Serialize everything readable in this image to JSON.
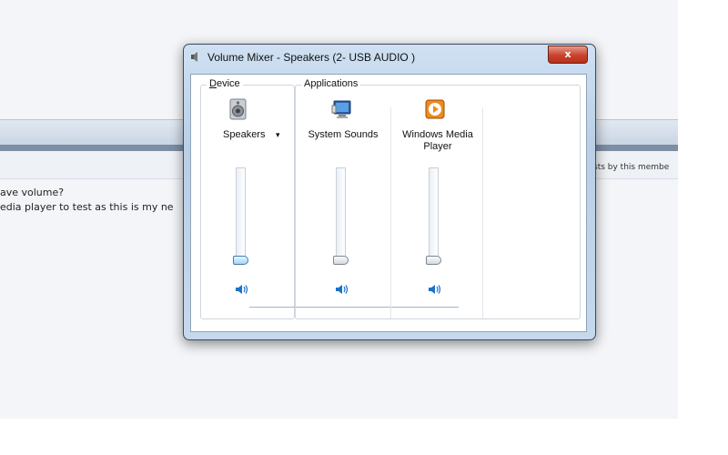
{
  "background": {
    "text_line1": "ave volume?",
    "text_line2": "edia player to test as this is my ne",
    "right_text": "sts by this membe"
  },
  "window": {
    "title": "Volume Mixer - Speakers (2- USB  AUDIO  )",
    "close_label": "x"
  },
  "device_group": {
    "legend_accel": "D",
    "legend_rest": "evice",
    "device_name": "Speakers",
    "dropdown_glyph": "▾",
    "level": 0.0
  },
  "applications_group": {
    "legend": "Applications",
    "apps": [
      {
        "name": "System Sounds",
        "level": 0.0
      },
      {
        "name_line1": "Windows Media",
        "name_line2": "Player",
        "level": 0.0
      }
    ]
  },
  "colors": {
    "accent_blue": "#1a73c9",
    "close_red": "#c9432c"
  }
}
